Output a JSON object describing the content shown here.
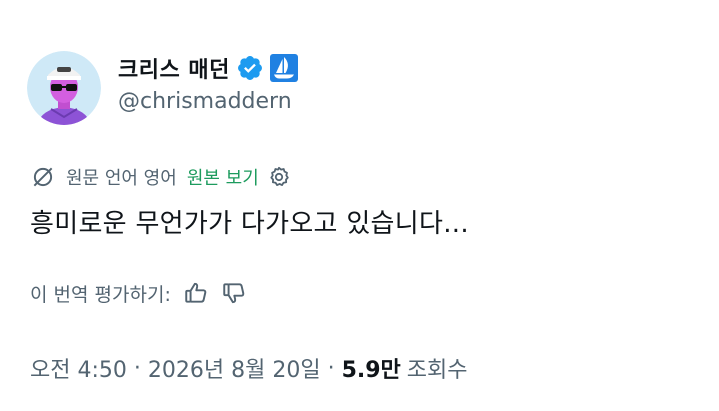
{
  "author": {
    "display_name": "크리스 매던",
    "handle": "@chrismaddern"
  },
  "translation": {
    "source_label": "원문 언어 영어",
    "show_original_label": "원본 보기"
  },
  "tweet": {
    "text": "흥미로운 무언가가 다가오고 있습니다..."
  },
  "rating": {
    "label": "이 번역 평가하기:"
  },
  "meta": {
    "time": "오전 4:50",
    "dot1": "·",
    "date": "2026년 8월 20일",
    "dot2": "·",
    "views_count": "5.9만",
    "views_label": "조회수"
  },
  "colors": {
    "verified": "#1d9bf0",
    "link_green": "#1d9b5e",
    "secondary_text": "#536471",
    "primary_text": "#0f1419",
    "opensea_blue": "#2081e2"
  },
  "icons": {
    "verified": "verified-badge-icon",
    "opensea": "opensea-icon",
    "translate": "globe-slash-icon",
    "settings": "gear-icon",
    "thumbs_up": "thumbs-up-icon",
    "thumbs_down": "thumbs-down-icon"
  }
}
